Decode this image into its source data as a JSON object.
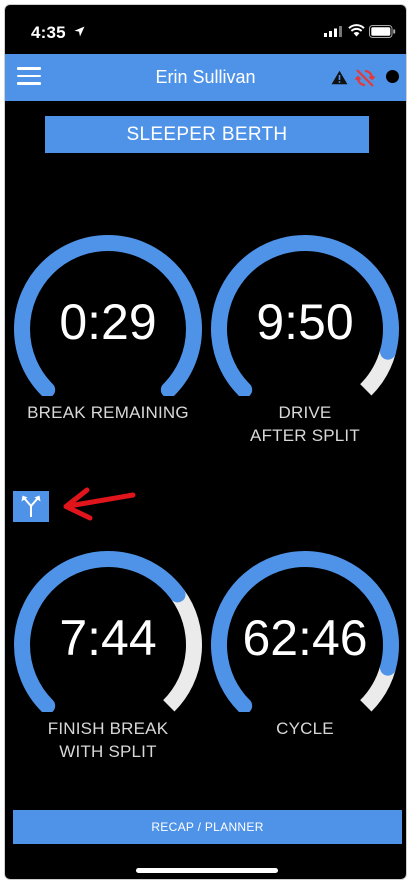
{
  "status_bar": {
    "time": "4:35"
  },
  "header": {
    "title": "Erin Sullivan"
  },
  "status_button": {
    "label": "SLEEPER BERTH"
  },
  "gauges": [
    {
      "value": "0:29",
      "label_lines": [
        "BREAK REMAINING"
      ],
      "remaining_fraction": 1.0
    },
    {
      "value": "9:50",
      "label_lines": [
        "DRIVE",
        "AFTER SPLIT"
      ],
      "remaining_fraction": 0.89
    },
    {
      "value": "7:44",
      "label_lines": [
        "FINISH BREAK",
        "WITH SPLIT"
      ],
      "remaining_fraction": 0.7
    },
    {
      "value": "62:46",
      "label_lines": [
        "CYCLE"
      ],
      "remaining_fraction": 0.89
    }
  ],
  "footer": {
    "recap_label": "RECAP / PLANNER"
  },
  "colors": {
    "accent": "#4f93e8",
    "track": "#ebebeb",
    "background": "#000000",
    "annotation_arrow": "#e0141b"
  },
  "icons": [
    "menu-icon",
    "warning-icon",
    "no-sync-icon",
    "status-dot-icon",
    "split-icon",
    "location-arrow-icon",
    "signal-icon",
    "wifi-icon",
    "battery-icon"
  ]
}
